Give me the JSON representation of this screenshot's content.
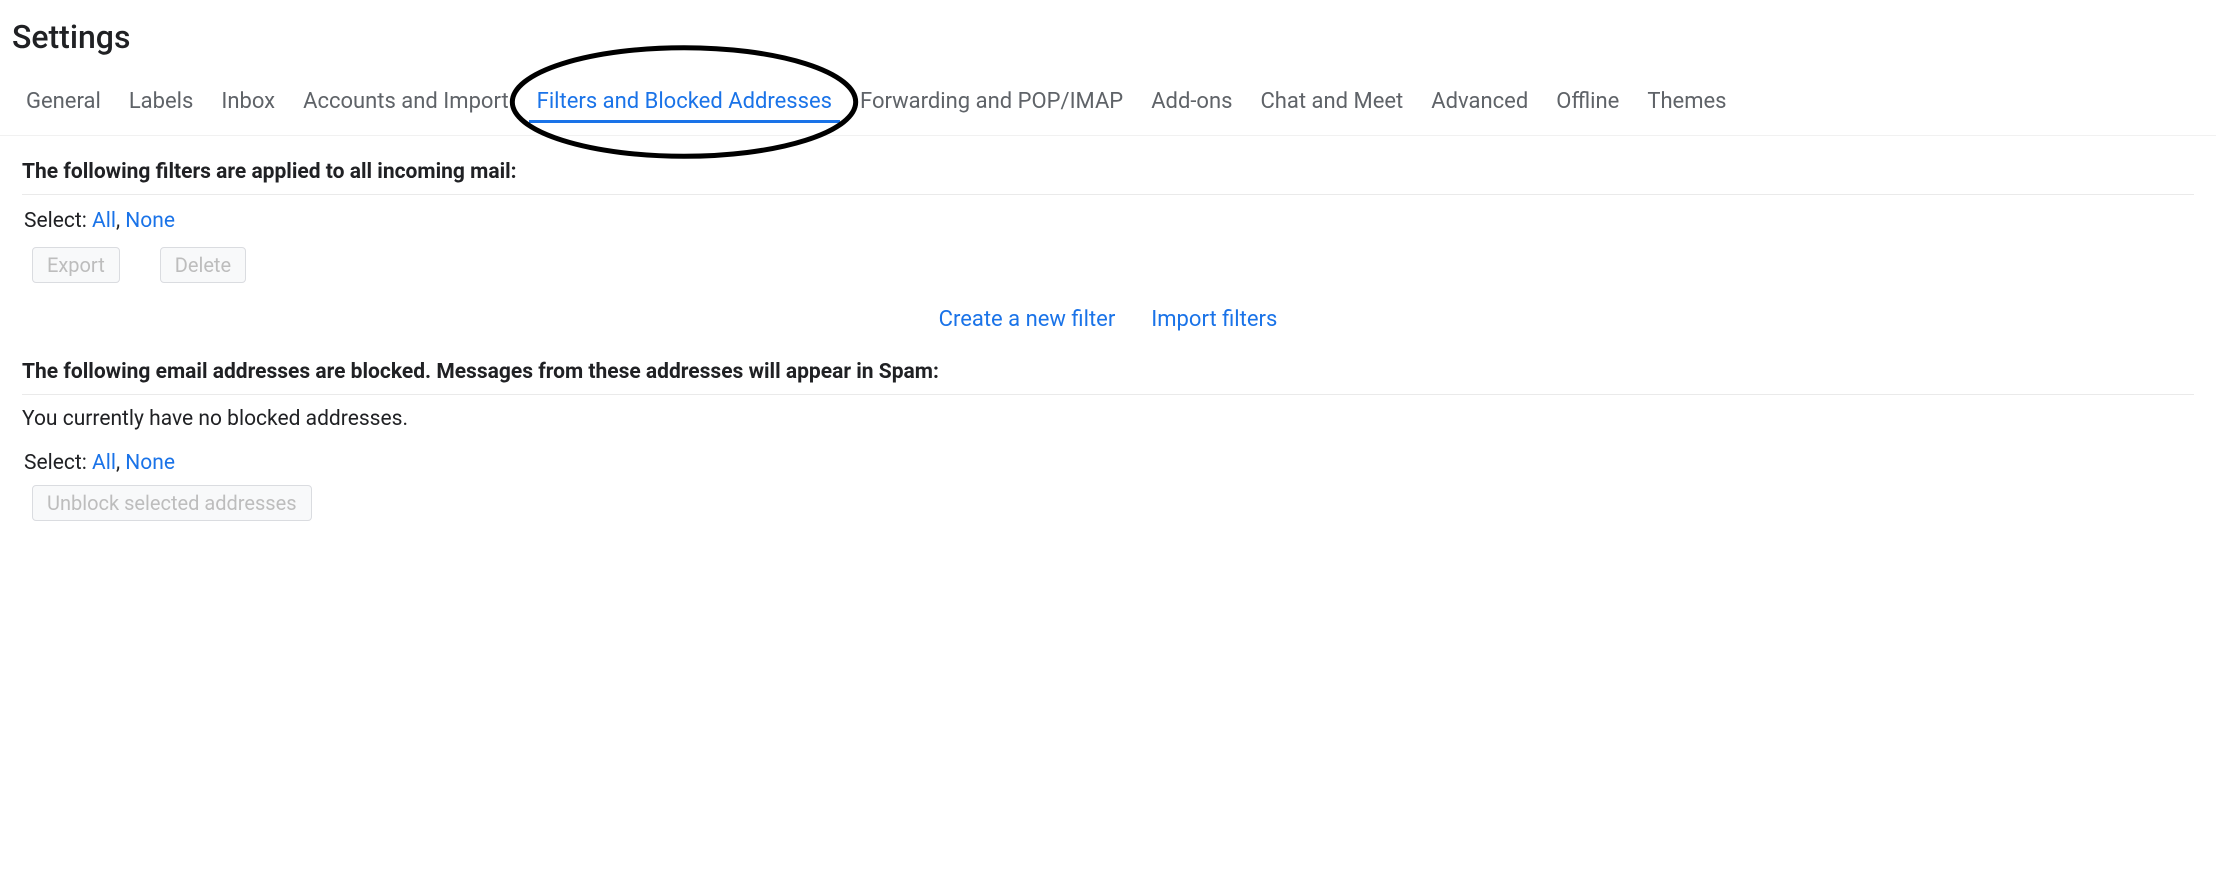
{
  "page": {
    "title": "Settings"
  },
  "tabs": {
    "general": "General",
    "labels": "Labels",
    "inbox": "Inbox",
    "accounts_import": "Accounts and Import",
    "filters_blocked": "Filters and Blocked Addresses",
    "forwarding_pop_imap": "Forwarding and POP/IMAP",
    "addons": "Add-ons",
    "chat_meet": "Chat and Meet",
    "advanced": "Advanced",
    "offline": "Offline",
    "themes": "Themes"
  },
  "filters_section": {
    "heading": "The following filters are applied to all incoming mail:",
    "select_label": "Select:",
    "select_all": "All",
    "select_sep": ", ",
    "select_none": "None",
    "export_btn": "Export",
    "delete_btn": "Delete",
    "create_link": "Create a new filter",
    "import_link": "Import filters"
  },
  "blocked_section": {
    "heading": "The following email addresses are blocked. Messages from these addresses will appear in Spam:",
    "empty_text": "You currently have no blocked addresses.",
    "select_label": "Select:",
    "select_all": "All",
    "select_sep": ", ",
    "select_none": "None",
    "unblock_btn": "Unblock selected addresses"
  }
}
